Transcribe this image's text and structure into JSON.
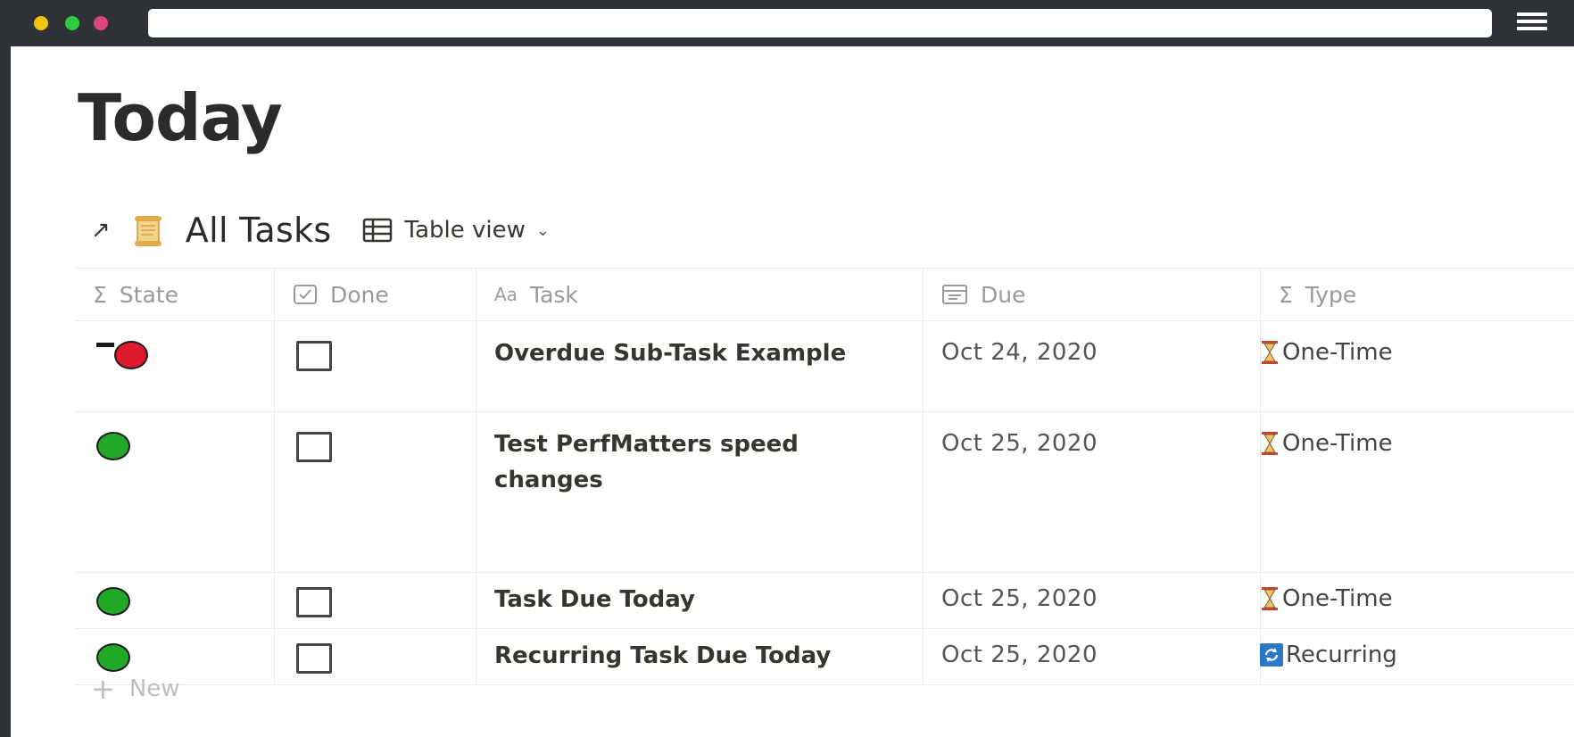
{
  "window": {
    "traffic_lights": [
      "yellow",
      "green",
      "red"
    ],
    "colors": {
      "yellow": "#f1c40f",
      "green": "#2ecc40",
      "red": "#e0457b",
      "chrome": "#2f3337"
    }
  },
  "page": {
    "title": "Today",
    "database": {
      "link_icon": "arrow-up-right-icon",
      "page_icon": "scroll-icon",
      "title": "All Tasks",
      "view_icon": "table-icon",
      "view_label": "Table view",
      "view_chevron": "chevron-down-icon"
    },
    "table": {
      "columns": [
        {
          "key": "state",
          "label": "State",
          "icon": "sigma-icon"
        },
        {
          "key": "done",
          "label": "Done",
          "icon": "checkbox-icon"
        },
        {
          "key": "task",
          "label": "Task",
          "icon": "text-aa-icon"
        },
        {
          "key": "due",
          "label": "Due",
          "icon": "calendar-icon"
        },
        {
          "key": "type",
          "label": "Type",
          "icon": "sigma-icon"
        }
      ],
      "rows": [
        {
          "state": "overdue",
          "state_color": "#e0182d",
          "done": false,
          "task": "Overdue Sub-Task Example",
          "due": "Oct 24, 2020",
          "type": "One-Time",
          "type_icon": "hourglass-icon"
        },
        {
          "state": "ok",
          "state_color": "#21a826",
          "done": false,
          "task": "Test PerfMatters speed changes",
          "due": "Oct 25, 2020",
          "type": "One-Time",
          "type_icon": "hourglass-icon"
        },
        {
          "state": "ok",
          "state_color": "#21a826",
          "done": false,
          "task": "Task Due Today",
          "due": "Oct 25, 2020",
          "type": "One-Time",
          "type_icon": "hourglass-icon"
        },
        {
          "state": "ok",
          "state_color": "#21a826",
          "done": false,
          "task": "Recurring Task Due Today",
          "due": "Oct 25, 2020",
          "type": "Recurring",
          "type_icon": "repeat-icon"
        }
      ],
      "new_row_label": "New"
    }
  }
}
